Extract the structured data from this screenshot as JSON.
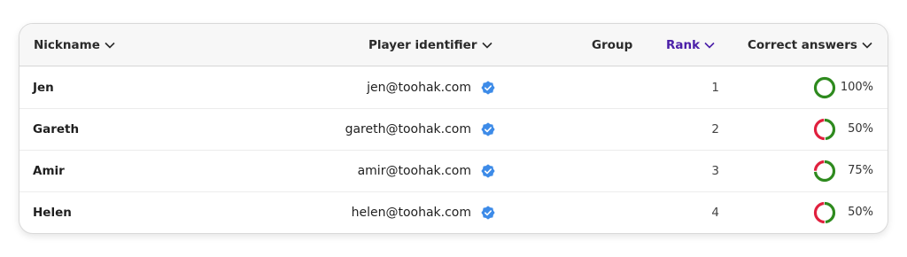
{
  "columns": {
    "nickname": "Nickname",
    "player_identifier": "Player identifier",
    "group": "Group",
    "rank": "Rank",
    "correct_answers": "Correct answers"
  },
  "colors": {
    "active_sort": "#4b1fa8",
    "correct": "#2e8a1e",
    "incorrect": "#e0203e",
    "verified": "#3d8be8"
  },
  "rows": [
    {
      "nickname": "Jen",
      "email": "jen@toohak.com",
      "verified_icon": "verified-badge-icon",
      "group": "",
      "rank": "1",
      "correct_pct_label": "100%",
      "correct_fraction": 1.0
    },
    {
      "nickname": "Gareth",
      "email": "gareth@toohak.com",
      "verified_icon": "verified-badge-icon",
      "group": "",
      "rank": "2",
      "correct_pct_label": "50%",
      "correct_fraction": 0.5
    },
    {
      "nickname": "Amir",
      "email": "amir@toohak.com",
      "verified_icon": "verified-badge-icon",
      "group": "",
      "rank": "3",
      "correct_pct_label": "75%",
      "correct_fraction": 0.75
    },
    {
      "nickname": "Helen",
      "email": "helen@toohak.com",
      "verified_icon": "verified-badge-icon",
      "group": "",
      "rank": "4",
      "correct_pct_label": "50%",
      "correct_fraction": 0.5
    }
  ]
}
